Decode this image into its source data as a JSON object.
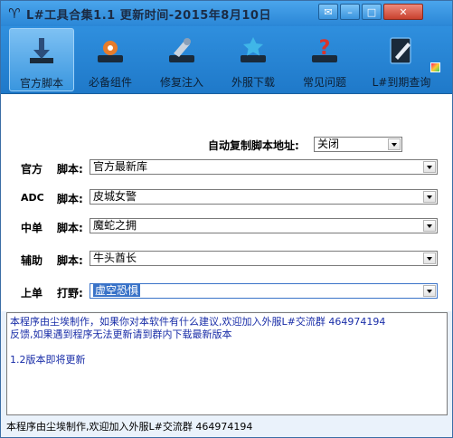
{
  "window": {
    "title": "L#工具合集1.1 更新时间-2015年8月10日",
    "app_icon": "bull-logo-icon",
    "buttons": [
      "chat-icon",
      "minimize-icon",
      "maximize-icon",
      "close-icon"
    ]
  },
  "toolbar": {
    "items": [
      {
        "label": "官方脚本",
        "icon": "download-arrow-icon",
        "active": true
      },
      {
        "label": "必备组件",
        "icon": "component-icon",
        "active": false
      },
      {
        "label": "修复注入",
        "icon": "repair-icon",
        "active": false
      },
      {
        "label": "外服下载",
        "icon": "star-download-icon",
        "active": false
      },
      {
        "label": "常见问题",
        "icon": "question-icon",
        "active": false
      },
      {
        "label": "L#到期查询",
        "icon": "notebook-pen-icon",
        "active": false
      }
    ]
  },
  "form": {
    "autocopy_label": "自动复制脚本地址:",
    "autocopy_value": "关闭",
    "rows": [
      {
        "category": "官方",
        "field": "脚本:",
        "value": "官方最新库"
      },
      {
        "category": "ADC",
        "field": "脚本:",
        "value": "皮城女警"
      },
      {
        "category": "中单",
        "field": "脚本:",
        "value": "魔蛇之拥"
      },
      {
        "category": "辅助",
        "field": "脚本:",
        "value": "牛头酋长"
      },
      {
        "category": "上单",
        "field": "打野:",
        "value": "虚空恐惧"
      }
    ]
  },
  "info": {
    "line1": "本程序由尘埃制作，如果你对本软件有什么建议,欢迎加入外服L#交流群 464974194",
    "line2": "反馈,如果遇到程序无法更新请到群内下载最新版本",
    "line3": "1.2版本即将更新"
  },
  "status": {
    "text": "本程序由尘埃制作,欢迎加入外服L#交流群 464974194"
  },
  "colors": {
    "titlebar": "#2a86d6",
    "toolbar": "#1f79c9",
    "info_text": "#1a2ea8",
    "selection": "#3a73c8"
  }
}
